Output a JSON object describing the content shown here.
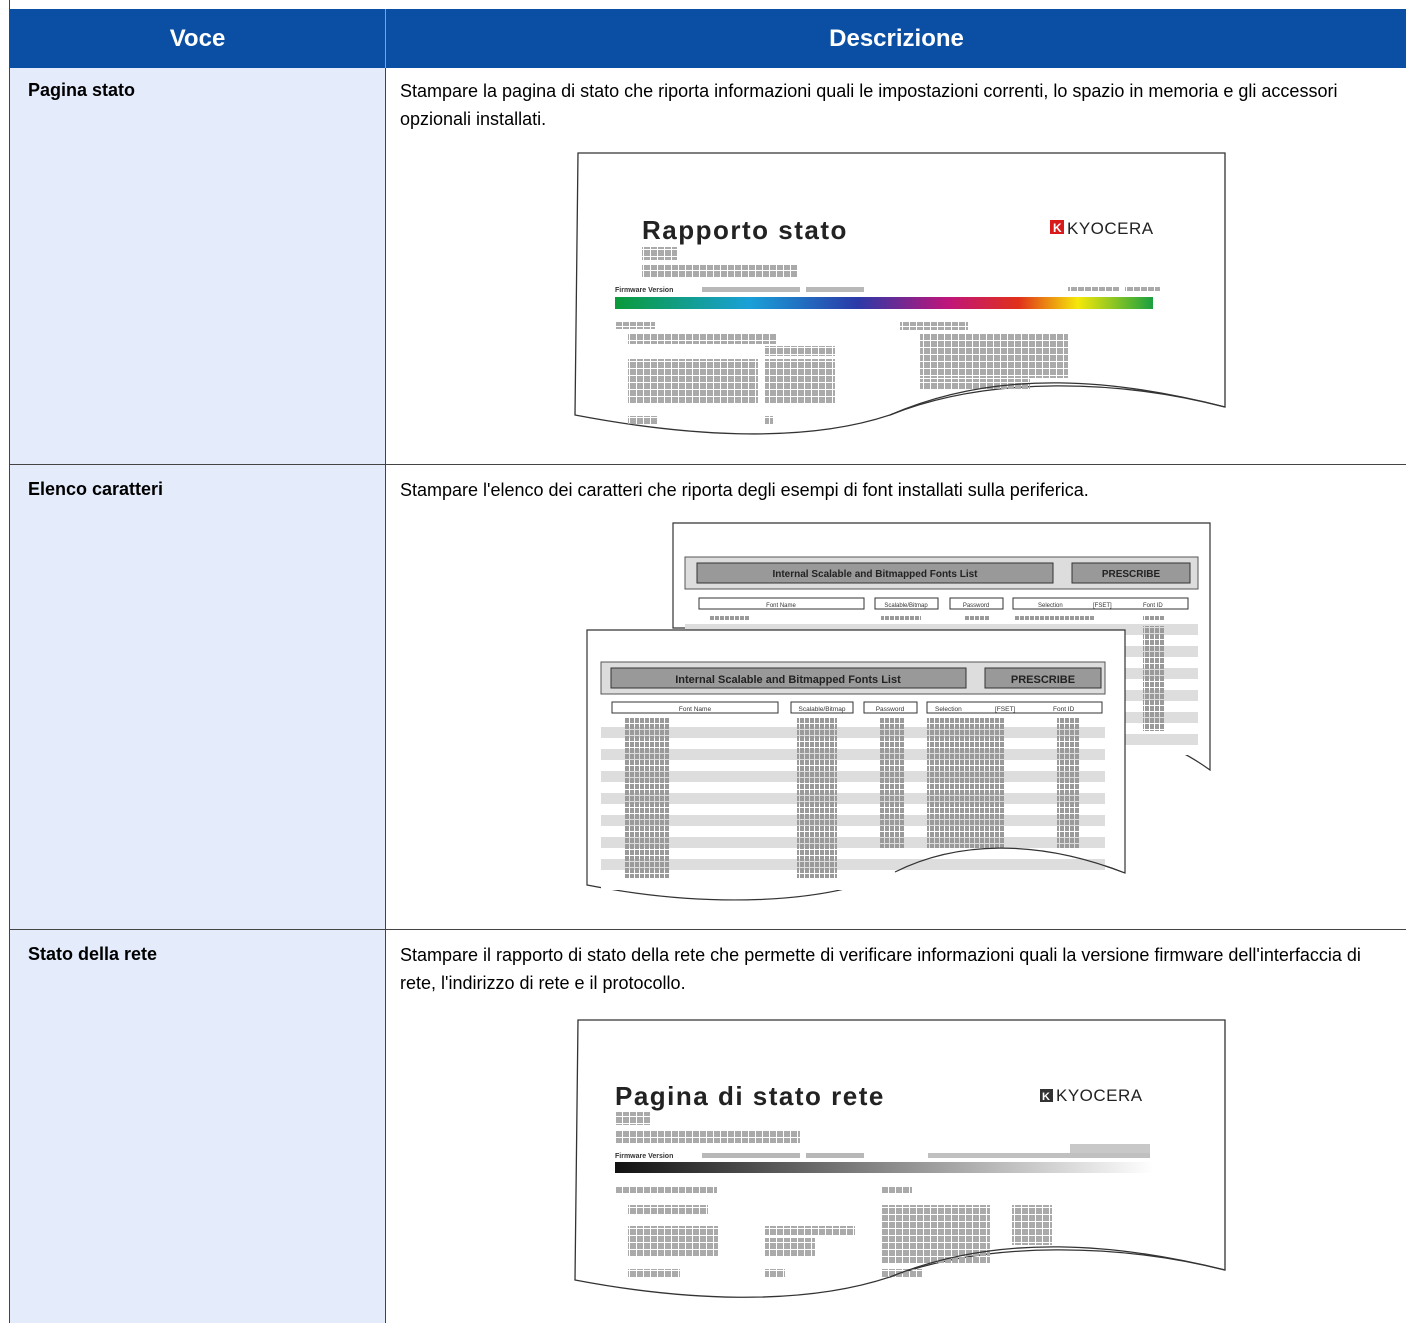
{
  "table": {
    "headers": [
      "Voce",
      "Descrizione"
    ],
    "rows": [
      {
        "item": "Pagina stato",
        "description": "Stampare la pagina di stato che riporta informazioni quali le impostazioni correnti, lo spazio in memoria e gli accessori opzionali installati.",
        "illustration": {
          "title": "Rapporto stato",
          "brand": "KYOCERA",
          "firmware_label": "Firmware Version"
        }
      },
      {
        "item": "Elenco caratteri",
        "description": "Stampare l'elenco dei caratteri che riporta degli esempi di font installati sulla periferica.",
        "illustration": {
          "banner": "Internal Scalable and Bitmapped Fonts List",
          "badge": "PRESCRIBE",
          "columns": [
            "Font Name",
            "Scalable/Bitmap",
            "Password",
            "Selection",
            "[FSET]",
            "Font ID"
          ]
        }
      },
      {
        "item": "Stato della rete",
        "description": "Stampare il rapporto di stato della rete che permette di verificare informazioni quali la versione firmware dell'interfaccia di rete, l'indirizzo di rete e il protocollo.",
        "illustration": {
          "title": "Pagina di stato rete",
          "brand": "KYOCERA",
          "firmware_label": "Firmware Version"
        }
      }
    ]
  },
  "colors": {
    "header_bg": "#0a4fa3",
    "left_column_bg": "#e4ecfb"
  }
}
